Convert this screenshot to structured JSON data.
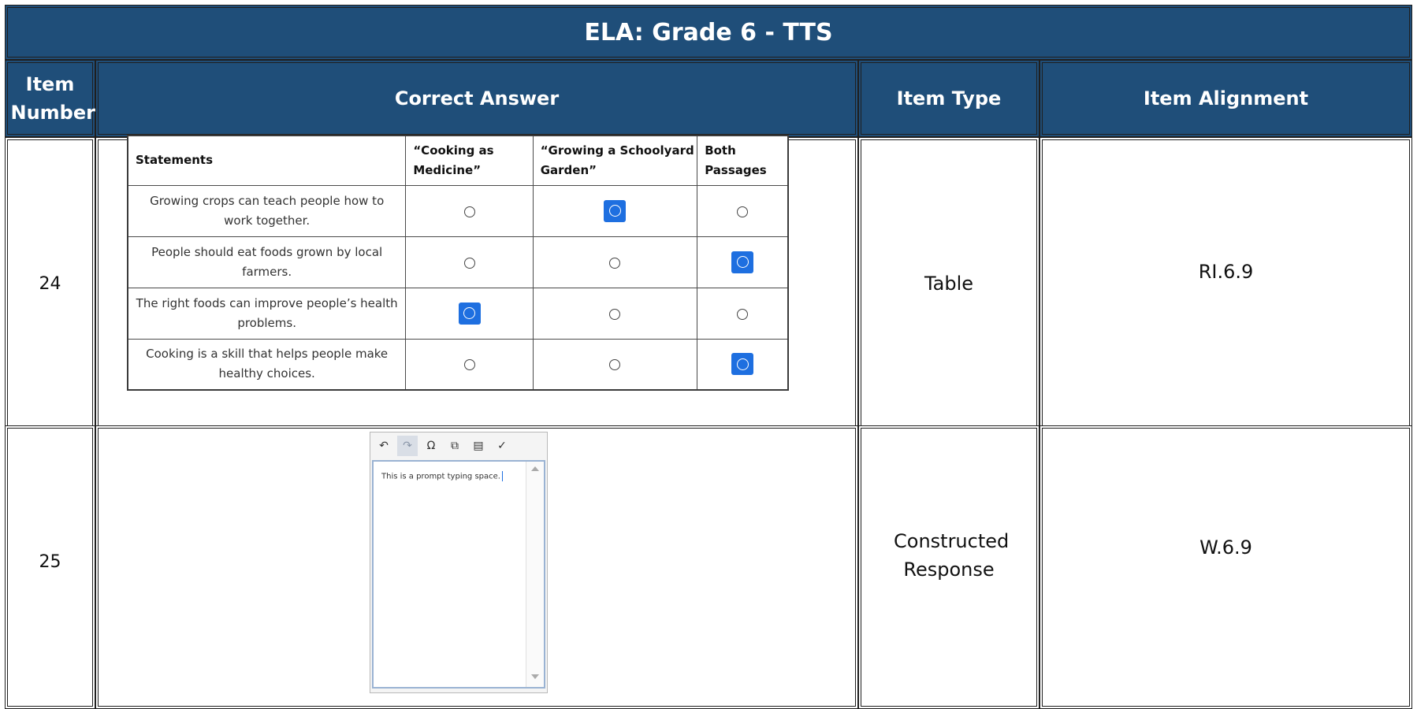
{
  "title": "ELA: Grade 6 - TTS",
  "headers": {
    "item_number": "Item Number",
    "correct_answer": "Correct Answer",
    "item_type": "Item Type",
    "item_alignment": "Item Alignment"
  },
  "rows": [
    {
      "number": "24",
      "type": "Table",
      "alignment": "RI.6.9"
    },
    {
      "number": "25",
      "type": "Constructed Response",
      "alignment": "W.6.9"
    }
  ],
  "answer_table": {
    "columns": [
      "Statements",
      "“Cooking as Medicine”",
      "“Growing a Schoolyard Garden”",
      "Both Passages"
    ],
    "rows": [
      {
        "statement": "Growing crops can teach people how to work together.",
        "selected": 1
      },
      {
        "statement": "People should eat foods grown by local farmers.",
        "selected": 2
      },
      {
        "statement": "The right foods can improve people’s health problems.",
        "selected": 0
      },
      {
        "statement": "Cooking is a skill that helps people make healthy choices.",
        "selected": 2
      }
    ]
  },
  "editor": {
    "text": "This is a prompt typing space.",
    "toolbar_icons": [
      "undo-icon",
      "redo-icon",
      "special-characters-icon",
      "copy-icon",
      "paste-icon",
      "spell-check-icon"
    ]
  },
  "colors": {
    "header_bg": "#1f4e79",
    "selected_radio": "#1e6fe0"
  }
}
